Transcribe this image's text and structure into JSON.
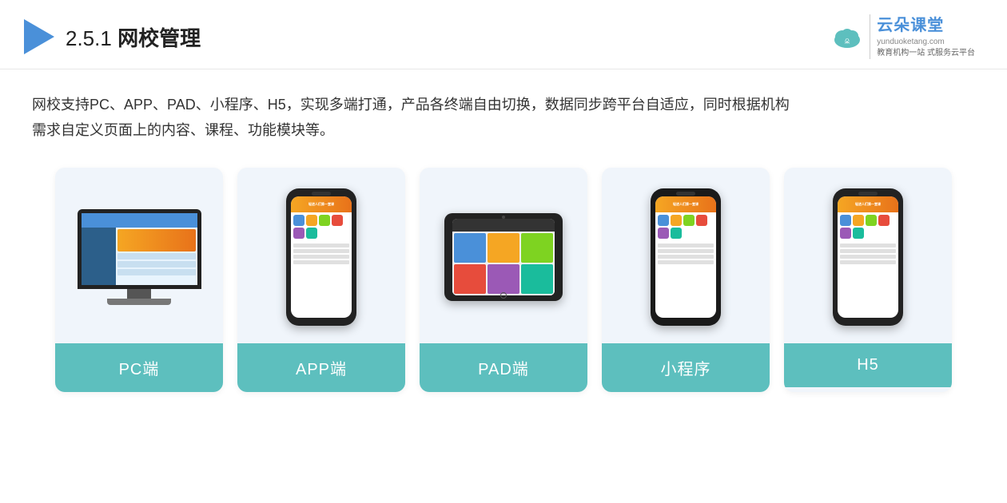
{
  "header": {
    "section_number": "2.5.1",
    "title_plain": "网校管理",
    "brand": {
      "name": "云朵课堂",
      "url": "yunduoketang.com",
      "slogan_line1": "教育机构一站",
      "slogan_line2": "式服务云平台"
    }
  },
  "description": {
    "line1": "网校支持PC、APP、PAD、小程序、H5，实现多端打通，产品各终端自由切换，数据同步跨平台自适应，同时根据机构",
    "line2": "需求自定义页面上的内容、课程、功能模块等。"
  },
  "cards": [
    {
      "id": "pc",
      "label": "PC端",
      "label_class": "pc-label"
    },
    {
      "id": "app",
      "label": "APP端",
      "label_class": "app-label"
    },
    {
      "id": "pad",
      "label": "PAD端",
      "label_class": "pad-label"
    },
    {
      "id": "mini",
      "label": "小程序",
      "label_class": "mini-label"
    },
    {
      "id": "h5",
      "label": "H5",
      "label_class": "h5-label"
    }
  ]
}
